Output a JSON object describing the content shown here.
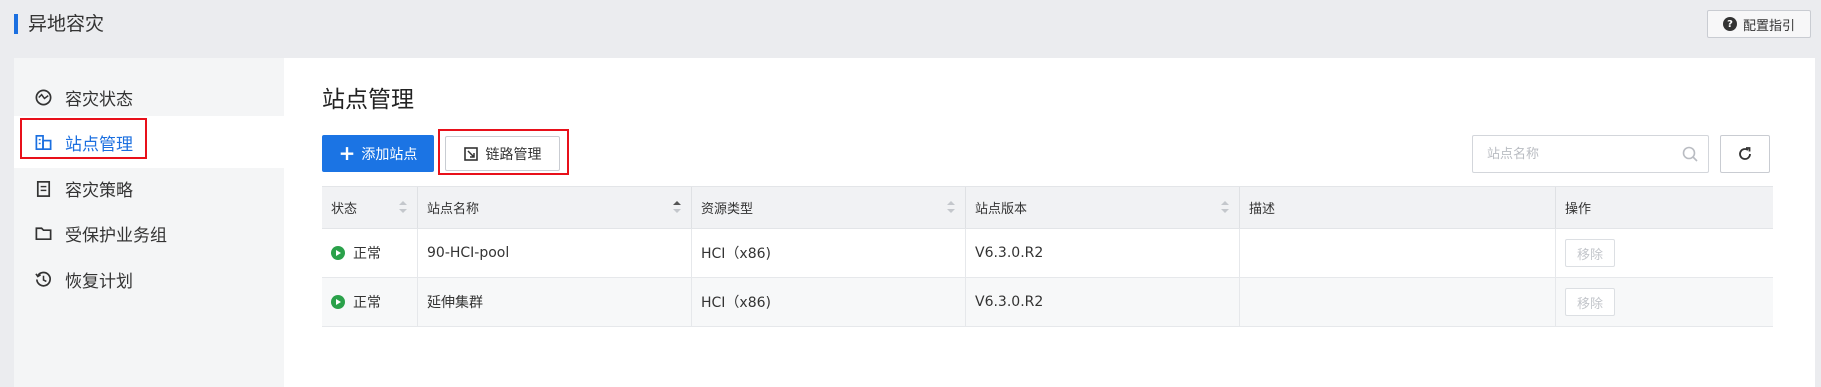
{
  "header": {
    "title": "异地容灾",
    "guide_label": "配置指引",
    "accent_color": "#1b6fe0"
  },
  "sidebar": {
    "items": [
      {
        "label": "容灾状态",
        "icon": "dashboard-icon",
        "active": false
      },
      {
        "label": "站点管理",
        "icon": "building-icon",
        "active": true
      },
      {
        "label": "容灾策略",
        "icon": "clipboard-icon",
        "active": false
      },
      {
        "label": "受保护业务组",
        "icon": "folder-icon",
        "active": false
      },
      {
        "label": "恢复计划",
        "icon": "history-icon",
        "active": false
      }
    ]
  },
  "main": {
    "title": "站点管理",
    "toolbar": {
      "add_label": "添加站点",
      "link_label": "链路管理",
      "search_placeholder": "站点名称"
    },
    "table": {
      "columns": [
        "状态",
        "站点名称",
        "资源类型",
        "站点版本",
        "描述",
        "操作"
      ],
      "rows": [
        {
          "status": "正常",
          "name": "90-HCI-pool",
          "type": "HCI（x86)",
          "version": "V6.3.0.R2",
          "desc": "",
          "action": "移除"
        },
        {
          "status": "正常",
          "name": "延伸集群",
          "type": "HCI（x86)",
          "version": "V6.3.0.R2",
          "desc": "",
          "action": "移除"
        }
      ]
    }
  },
  "colors": {
    "primary": "#1b74e4",
    "status_ok": "#2aa14a",
    "highlight": "#e8101a"
  }
}
